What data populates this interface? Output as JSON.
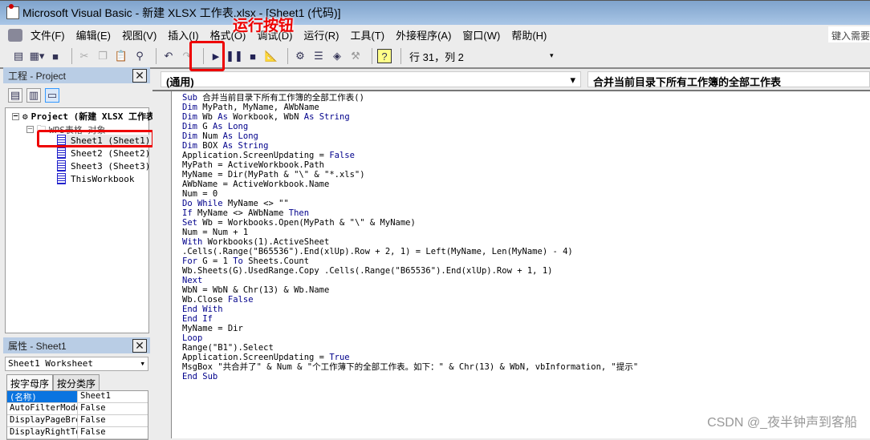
{
  "window": {
    "title": "Microsoft Visual Basic - 新建 XLSX 工作表.xlsx - [Sheet1 (代码)]"
  },
  "menu": [
    "文件(F)",
    "编辑(E)",
    "视图(V)",
    "插入(I)",
    "格式(O)",
    "调试(D)",
    "运行(R)",
    "工具(T)",
    "外接程序(A)",
    "窗口(W)",
    "帮助(H)"
  ],
  "help_box": "键入需要帮助的问题",
  "toolbar": {
    "position": "行 31，列 2"
  },
  "annotation": "运行按钮",
  "project": {
    "title": "工程 - Project",
    "root": "Project (新建 XLSX 工作表.xlsx)",
    "folder": "WPS表格 对象",
    "items": [
      "Sheet1 (Sheet1)",
      "Sheet2 (Sheet2)",
      "Sheet3 (Sheet3)",
      "ThisWorkbook"
    ]
  },
  "properties": {
    "title": "属性 - Sheet1",
    "object": "Sheet1 Worksheet",
    "tabs": [
      "按字母序",
      "按分类序"
    ],
    "rows": [
      [
        "(名称)",
        "Sheet1"
      ],
      [
        "AutoFilterMode",
        "False"
      ],
      [
        "DisplayPageBreaks",
        "False"
      ],
      [
        "DisplayRightToLeft",
        "False"
      ]
    ]
  },
  "code": {
    "object_dropdown": "(通用)",
    "proc_dropdown": "合并当前目录下所有工作簿的全部工作表",
    "lines": [
      [
        [
          "Sub ",
          1
        ],
        [
          "合并当前目录下所有工作簿的全部工作表()",
          0
        ]
      ],
      [
        [
          "Dim ",
          1
        ],
        [
          "MyPath, MyName, AWbName",
          0
        ]
      ],
      [
        [
          "Dim ",
          1
        ],
        [
          "Wb ",
          0
        ],
        [
          "As ",
          1
        ],
        [
          "Workbook, WbN ",
          0
        ],
        [
          "As String",
          1
        ]
      ],
      [
        [
          "Dim ",
          1
        ],
        [
          "G ",
          0
        ],
        [
          "As Long",
          1
        ]
      ],
      [
        [
          "Dim ",
          1
        ],
        [
          "Num ",
          0
        ],
        [
          "As Long",
          1
        ]
      ],
      [
        [
          "Dim ",
          1
        ],
        [
          "BOX ",
          0
        ],
        [
          "As String",
          1
        ]
      ],
      [
        [
          "Application.ScreenUpdating = ",
          0
        ],
        [
          "False",
          1
        ]
      ],
      [
        [
          "MyPath = ActiveWorkbook.Path",
          0
        ]
      ],
      [
        [
          "MyName = Dir(MyPath & \"\\\" & \"*.xls\")",
          0
        ]
      ],
      [
        [
          "AWbName = ActiveWorkbook.Name",
          0
        ]
      ],
      [
        [
          "Num = 0",
          0
        ]
      ],
      [
        [
          "Do While ",
          1
        ],
        [
          "MyName <> \"\"",
          0
        ]
      ],
      [
        [
          "If ",
          1
        ],
        [
          "MyName <> AWbName ",
          0
        ],
        [
          "Then",
          1
        ]
      ],
      [
        [
          "Set ",
          1
        ],
        [
          "Wb = Workbooks.Open(MyPath & \"\\\" & MyName)",
          0
        ]
      ],
      [
        [
          "Num = Num + 1",
          0
        ]
      ],
      [
        [
          "With ",
          1
        ],
        [
          "Workbooks(1).ActiveSheet",
          0
        ]
      ],
      [
        [
          ".Cells(.Range(\"B65536\").End(xlUp).Row + 2, 1) = Left(MyName, Len(MyName) - 4)",
          0
        ]
      ],
      [
        [
          "For ",
          1
        ],
        [
          "G = 1 ",
          0
        ],
        [
          "To ",
          1
        ],
        [
          "Sheets.Count",
          0
        ]
      ],
      [
        [
          "Wb.Sheets(G).UsedRange.Copy .Cells(.Range(\"B65536\").End(xlUp).Row + 1, 1)",
          0
        ]
      ],
      [
        [
          "Next",
          1
        ]
      ],
      [
        [
          "WbN = WbN & Chr(13) & Wb.Name",
          0
        ]
      ],
      [
        [
          "Wb.Close ",
          0
        ],
        [
          "False",
          1
        ]
      ],
      [
        [
          "End With",
          1
        ]
      ],
      [
        [
          "End If",
          1
        ]
      ],
      [
        [
          "MyName = Dir",
          0
        ]
      ],
      [
        [
          "Loop",
          1
        ]
      ],
      [
        [
          "Range(\"B1\").Select",
          0
        ]
      ],
      [
        [
          "Application.ScreenUpdating = ",
          0
        ],
        [
          "True",
          1
        ]
      ],
      [
        [
          "MsgBox \"共合并了\" & Num & \"个工作薄下的全部工作表。如下：\" & Chr(13) & WbN, vbInformation, \"提示\"",
          0
        ]
      ],
      [
        [
          "End Sub",
          1
        ]
      ]
    ]
  },
  "watermark": "CSDN @_夜半钟声到客船",
  "colors": {
    "keyword": "#00008b",
    "annotation": "#ee0000",
    "selection": "#0a74e0"
  }
}
